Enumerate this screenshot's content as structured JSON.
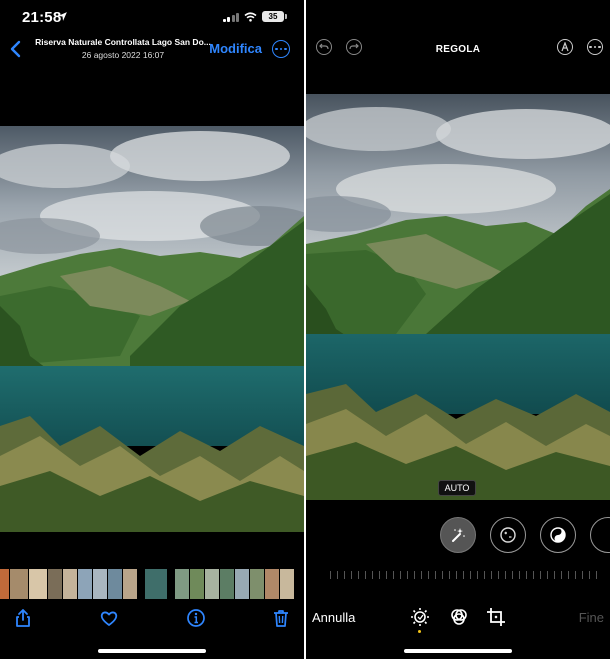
{
  "status_bar": {
    "time": "21:58",
    "battery": "35"
  },
  "viewer": {
    "title": "Riserva Naturale Controllata Lago San Do...",
    "subtitle": "26 agosto 2022  16:07",
    "edit_label": "Modifica"
  },
  "editor": {
    "header_title": "REGOLA",
    "auto_label": "AUTO",
    "cancel_label": "Annulla",
    "done_label": "Fine"
  },
  "icons": {
    "viewer_nav": [
      "back-chevron",
      "more-circle"
    ],
    "viewer_toolbar": [
      "share",
      "heart",
      "info",
      "trash"
    ],
    "editor_header": [
      "undo",
      "redo",
      "markup-pen",
      "more-circle"
    ],
    "editor_adjustments": [
      "auto-magic-wand",
      "exposure",
      "brilliance",
      "highlights"
    ],
    "editor_modes": [
      "adjust-dial",
      "filters",
      "crop-rotate"
    ]
  },
  "colors": {
    "accent": "#2f86ff",
    "marker": "#f5c518"
  }
}
